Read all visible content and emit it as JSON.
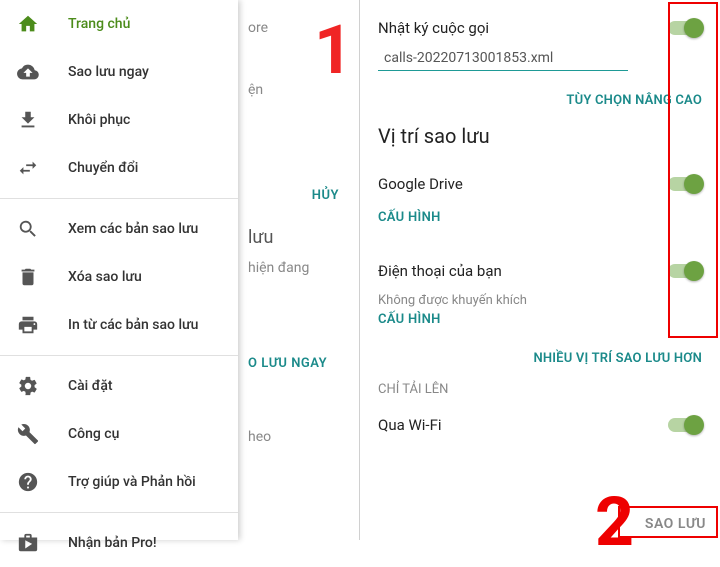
{
  "left": {
    "drawer": [
      {
        "icon": "home",
        "label": "Trang chủ",
        "active": true
      },
      {
        "icon": "cloud-up",
        "label": "Sao lưu ngay"
      },
      {
        "icon": "download",
        "label": "Khôi phục"
      },
      {
        "icon": "swap",
        "label": "Chuyển đổi"
      },
      {
        "sep": true
      },
      {
        "icon": "search",
        "label": "Xem các bản sao lưu"
      },
      {
        "icon": "trash",
        "label": "Xóa sao lưu"
      },
      {
        "icon": "print",
        "label": "In từ các bản sao lưu"
      },
      {
        "sep": true
      },
      {
        "icon": "gear",
        "label": "Cài đặt"
      },
      {
        "icon": "wrench",
        "label": "Công cụ"
      },
      {
        "icon": "help",
        "label": "Trợ giúp và Phản hồi"
      },
      {
        "sep": true
      },
      {
        "icon": "shop",
        "label": "Nhận bản Pro!"
      }
    ],
    "bg": {
      "t1": "ore",
      "t2": "ện",
      "huy": "HỦY",
      "t3": "lưu",
      "t4": "hiện đang",
      "btn": "O LƯU NGAY",
      "t5": "heo"
    },
    "num": "1"
  },
  "right": {
    "log_label": "Nhật ký cuộc gọi",
    "filename": "calls-20220713001853.xml",
    "adv_header": "TÙY CHỌN NÂNG CAO",
    "loc_title": "Vị trí sao lưu",
    "gdrive": "Google Drive",
    "cfg": "CẤU HÌNH",
    "phone": "Điện thoại của bạn",
    "phone_sub": "Không được khuyến khích",
    "more_loc": "NHIỀU VỊ TRÍ SAO LƯU HƠN",
    "upload_only": "CHỈ TẢI LÊN",
    "wifi": "Qua Wi-Fi",
    "save": "SAO LƯU",
    "num": "2"
  }
}
